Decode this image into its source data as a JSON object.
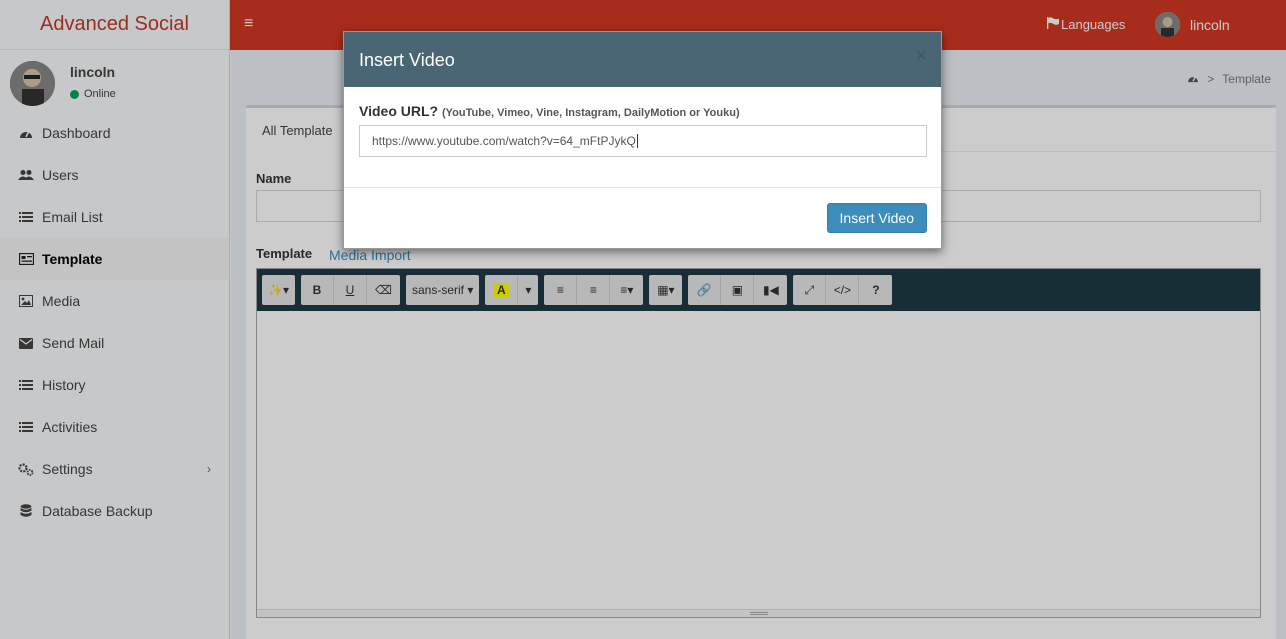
{
  "app": {
    "title": "Advanced Social"
  },
  "user": {
    "name": "lincoln",
    "status": "Online"
  },
  "sidebar": {
    "items": [
      {
        "label": "Dashboard",
        "icon": "dashboard-icon"
      },
      {
        "label": "Users",
        "icon": "users-icon"
      },
      {
        "label": "Email List",
        "icon": "list-icon"
      },
      {
        "label": "Template",
        "icon": "template-icon",
        "active": true
      },
      {
        "label": "Media",
        "icon": "image-icon"
      },
      {
        "label": "Send Mail",
        "icon": "envelope-icon"
      },
      {
        "label": "History",
        "icon": "list-icon"
      },
      {
        "label": "Activities",
        "icon": "list-icon"
      },
      {
        "label": "Settings",
        "icon": "gears-icon",
        "has_submenu": true
      },
      {
        "label": "Database Backup",
        "icon": "database-icon"
      }
    ]
  },
  "header": {
    "languages": "Languages",
    "user_name": "lincoln"
  },
  "breadcrumb": {
    "current": "Template"
  },
  "form": {
    "tab_label": "All Template",
    "name_label": "Name",
    "template_label": "Template",
    "media_import": "Media Import",
    "font_name": "sans-serif"
  },
  "modal": {
    "title": "Insert Video",
    "close": "×",
    "url_label": "Video URL?",
    "url_hint": "(YouTube, Vimeo, Vine, Instagram, DailyMotion or Youku)",
    "url_value": "https://www.youtube.com/watch?v=64_mFtPJykQ",
    "insert_button": "Insert Video"
  },
  "colors": {
    "header": "#d33724",
    "modal_header": "#4a6675",
    "primary": "#3c8dbc",
    "toolbar": "#1e3a44"
  }
}
